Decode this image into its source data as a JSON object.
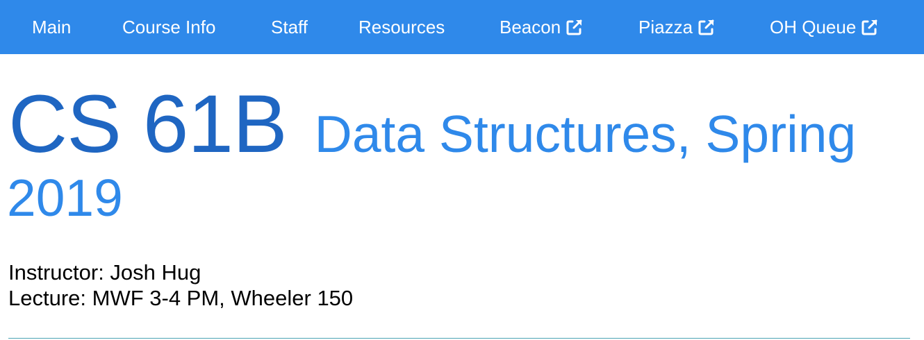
{
  "nav": {
    "items": [
      {
        "label": "Main",
        "external": false
      },
      {
        "label": "Course Info",
        "external": false
      },
      {
        "label": "Staff",
        "external": false
      },
      {
        "label": "Resources",
        "external": false
      },
      {
        "label": "Beacon",
        "external": true
      },
      {
        "label": "Piazza",
        "external": true
      },
      {
        "label": "OH Queue",
        "external": true
      }
    ],
    "external_icon": "external-link-icon",
    "background_color": "#2f89ea",
    "text_color": "#ffffff"
  },
  "header": {
    "course_code": "CS 61B",
    "course_name_line1": "Data Structures, Spring",
    "course_name_line2": "2019",
    "code_color": "#1f66c2",
    "name_color": "#2f89ea"
  },
  "info": {
    "instructor": "Instructor: Josh Hug",
    "lecture": "Lecture: MWF 3-4 PM, Wheeler 150"
  }
}
